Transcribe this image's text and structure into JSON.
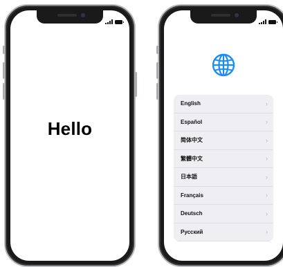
{
  "hello_screen": {
    "greeting": "Hello"
  },
  "language_screen": {
    "globe_icon": "globe-icon",
    "accent_color": "#1a8cff",
    "languages": [
      {
        "label": "English"
      },
      {
        "label": "Español"
      },
      {
        "label": "简体中文"
      },
      {
        "label": "繁體中文"
      },
      {
        "label": "日本語"
      },
      {
        "label": "Français"
      },
      {
        "label": "Deutsch"
      },
      {
        "label": "Русский"
      }
    ],
    "chevron": "›"
  }
}
